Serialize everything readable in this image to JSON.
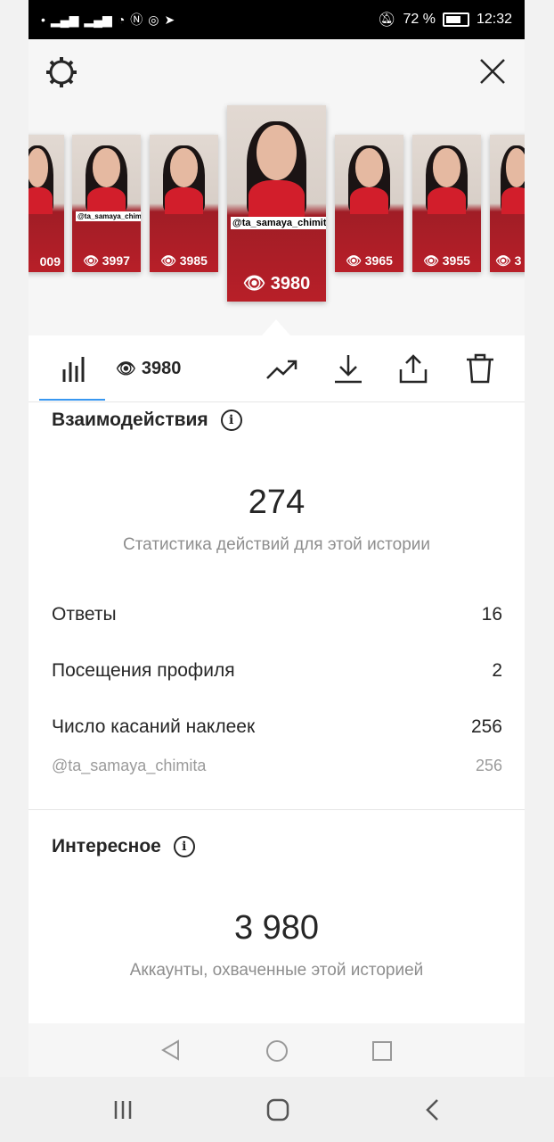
{
  "status_bar": {
    "battery": "72 %",
    "time": "12:32"
  },
  "stories": [
    {
      "handle": "",
      "views": "009",
      "position": "far-left-partial"
    },
    {
      "handle": "@ta_samaya_chimita",
      "views": "3997"
    },
    {
      "handle": "",
      "views": "3985"
    },
    {
      "handle": "@ta_samaya_chimita",
      "views": "3980",
      "selected": true
    },
    {
      "handle": "",
      "views": "3965"
    },
    {
      "handle": "",
      "views": "3955"
    },
    {
      "handle": "",
      "views": "3",
      "position": "far-right-partial"
    }
  ],
  "tabs": {
    "views": "3980"
  },
  "interactions": {
    "title": "Взаимодействия",
    "total": "274",
    "subtitle": "Статистика действий для этой истории",
    "rows": [
      {
        "label": "Ответы",
        "value": "16"
      },
      {
        "label": "Посещения профиля",
        "value": "2"
      },
      {
        "label": "Число касаний наклеек",
        "value": "256"
      }
    ],
    "sticker_row": {
      "label": "@ta_samaya_chimita",
      "value": "256"
    }
  },
  "discovery": {
    "title": "Интересное",
    "total": "3 980",
    "subtitle": "Аккаунты, охваченные этой историей"
  },
  "icons": {
    "settings": "gear-icon",
    "close": "close-icon",
    "insights": "bar-chart-icon",
    "eye": "eye-icon",
    "trend": "trend-icon",
    "download": "download-icon",
    "share": "share-icon",
    "delete": "trash-icon",
    "info": "info-icon"
  },
  "colors": {
    "accent": "#3897f0",
    "story_red": "#b81f28"
  }
}
